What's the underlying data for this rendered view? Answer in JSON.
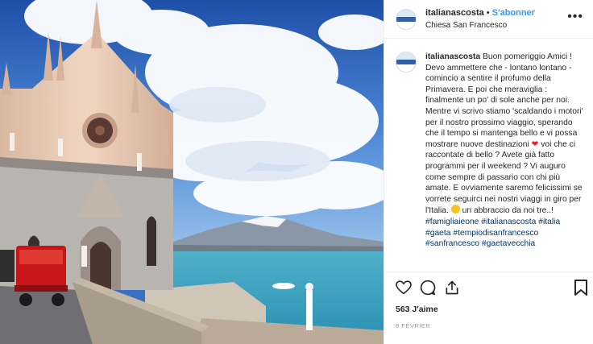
{
  "post": {
    "username": "italianascosta",
    "separator": "•",
    "follow_label": "S'abonner",
    "location": "Chiesa San Francesco",
    "more_icon": "ellipsis-icon"
  },
  "comment": {
    "username": "italianascosta",
    "text_1": "Buon pomeriggio Amici ! Devo ammettere che - lontano lontano - comincio a sentire il profumo della Primavera. E poi che meraviglia : finalmente un po' di sole anche per noi. Mentre vi scrivo stiamo 'scaldando i motori' per il nostro prossimo viaggio, sperando che il tempo si mantenga bello e vi possa mostrare nuove destinazioni",
    "text_2": "voi che ci raccontate di bello ? Avete già fatto programmi per il weekend ? Vi auguro come sempre di passario con chi più amate. E ovviamente saremo felicissimi se vorrete seguirci nei nostri viaggi in giro per l'Italia.",
    "text_3": "un abbraccio da noi tre..!",
    "emoji_heart": "❤",
    "hashtags": [
      "#famigliaieone",
      "#italianascosta",
      "#italia",
      "#gaeta",
      "#tempiodisanfrancesco",
      "#sanfrancesco",
      "#gaetavecchia"
    ]
  },
  "actions": {
    "likes": "563 J'aime",
    "date": "8 février",
    "icons": [
      "heart-icon",
      "comment-icon",
      "share-icon",
      "bookmark-icon"
    ]
  },
  "colors": {
    "accent": "#3897f0",
    "hashtag": "#003569",
    "text": "#262626",
    "muted": "#999999"
  }
}
